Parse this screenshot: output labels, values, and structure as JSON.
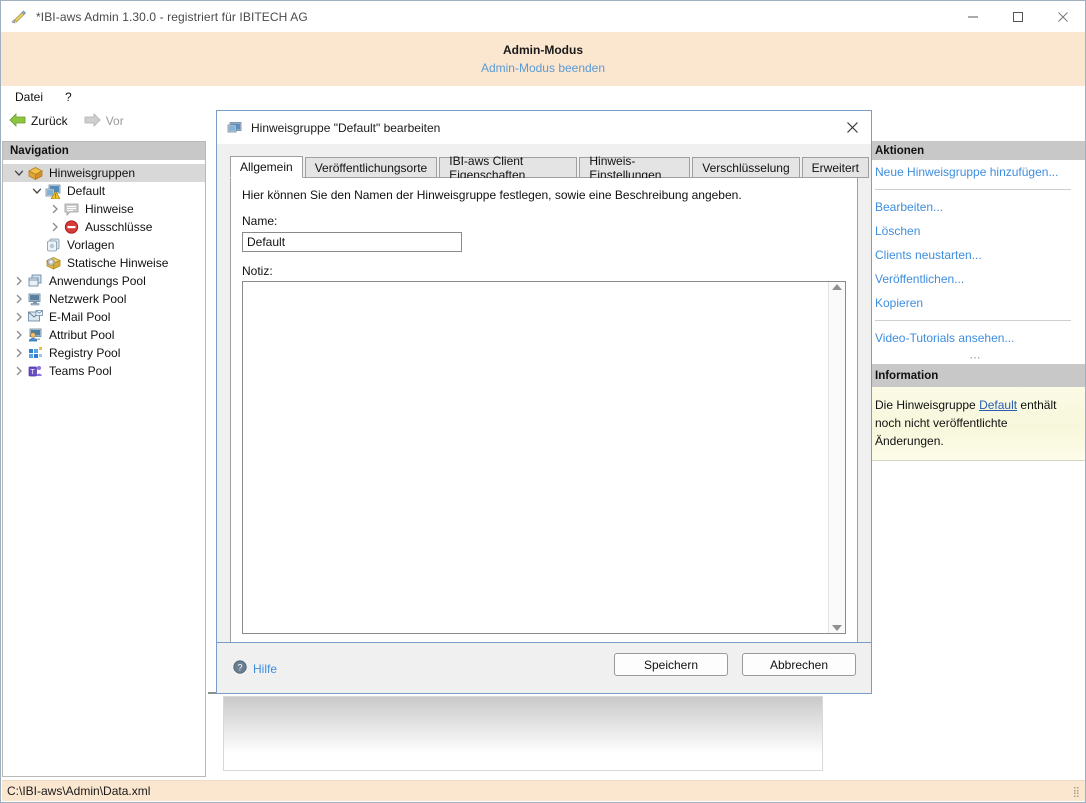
{
  "window": {
    "title": "*IBI-aws Admin 1.30.0 - registriert für IBITECH AG",
    "icon": "app-pencil-icon",
    "controls": {
      "minimize": "minimize-icon",
      "maximize": "maximize-icon",
      "close": "close-icon"
    }
  },
  "admin_banner": {
    "title": "Admin-Modus",
    "link": "Admin-Modus beenden"
  },
  "menubar": {
    "items": [
      "Datei",
      "?"
    ]
  },
  "navbar": {
    "back": "Zurück",
    "forward": "Vor"
  },
  "sidebar": {
    "header": "Navigation",
    "items": [
      {
        "label": "Hinweisgruppen",
        "icon": "box-icon",
        "indent": 0,
        "twisty": "down",
        "selected": true
      },
      {
        "label": "Default",
        "icon": "monitor-warn-icon",
        "indent": 1,
        "twisty": "down",
        "selected": false
      },
      {
        "label": "Hinweise",
        "icon": "speech-icon",
        "indent": 2,
        "twisty": "right",
        "selected": false
      },
      {
        "label": "Ausschlüsse",
        "icon": "block-icon",
        "indent": 2,
        "twisty": "right",
        "selected": false
      },
      {
        "label": "Vorlagen",
        "icon": "copies-icon",
        "indent": 1,
        "twisty": "none",
        "selected": false
      },
      {
        "label": "Statische Hinweise",
        "icon": "gear-box-icon",
        "indent": 1,
        "twisty": "none",
        "selected": false
      },
      {
        "label": "Anwendungs Pool",
        "icon": "windows-icon",
        "indent": 0,
        "twisty": "right",
        "selected": false
      },
      {
        "label": "Netzwerk Pool",
        "icon": "network-icon",
        "indent": 0,
        "twisty": "right",
        "selected": false
      },
      {
        "label": "E-Mail Pool",
        "icon": "mail-icon",
        "indent": 0,
        "twisty": "right",
        "selected": false
      },
      {
        "label": "Attribut Pool",
        "icon": "user-screen-icon",
        "indent": 0,
        "twisty": "right",
        "selected": false
      },
      {
        "label": "Registry Pool",
        "icon": "registry-icon",
        "indent": 0,
        "twisty": "right",
        "selected": false
      },
      {
        "label": "Teams Pool",
        "icon": "teams-icon",
        "indent": 0,
        "twisty": "right",
        "selected": false
      }
    ]
  },
  "right_panel": {
    "header": "Aktionen",
    "links": [
      "Neue Hinweisgruppe hinzufügen...",
      "Bearbeiten...",
      "Löschen",
      "Clients neustarten...",
      "Veröffentlichen...",
      "Kopieren",
      "Video-Tutorials ansehen..."
    ],
    "separator_after": [
      0,
      5
    ],
    "grip": "⋯",
    "notification": {
      "header": "Information",
      "text_before": "Die Hinweisgruppe ",
      "link": "Default",
      "text_after": " enthält noch nicht veröffentlichte Änderungen."
    }
  },
  "statusbar": {
    "path": "C:\\IBI-aws\\Admin\\Data.xml"
  },
  "dialog": {
    "title": "Hinweisgruppe \"Default\" bearbeiten",
    "icon": "monitor-icon",
    "close_icon": "close-icon",
    "tabs": [
      {
        "label": "Allgemein",
        "active": true
      },
      {
        "label": "Veröffentlichungsorte",
        "active": false
      },
      {
        "label": "IBI-aws Client Eigenschaften",
        "active": false
      },
      {
        "label": "Hinweis-Einstellungen",
        "active": false
      },
      {
        "label": "Verschlüsselung",
        "active": false
      },
      {
        "label": "Erweitert",
        "active": false
      }
    ],
    "general": {
      "intro": "Hier können Sie den Namen der Hinweisgruppe festlegen, sowie eine Beschreibung angeben.",
      "name_label": "Name:",
      "name_value": "Default",
      "name_placeholder": "",
      "notiz_label": "Notiz:",
      "notiz_value": "",
      "notiz_placeholder": ""
    },
    "footer": {
      "help_label": "Hilfe",
      "help_icon": "help-icon",
      "save_label": "Speichern",
      "cancel_label": "Abbrechen"
    }
  },
  "colors": {
    "accent_link": "#3e8ede",
    "banner_bg": "#fbe6d0",
    "panel_header": "#c8c8c8",
    "dialog_border": "#7a9cc6",
    "note_bg": "#f7f7dc"
  }
}
